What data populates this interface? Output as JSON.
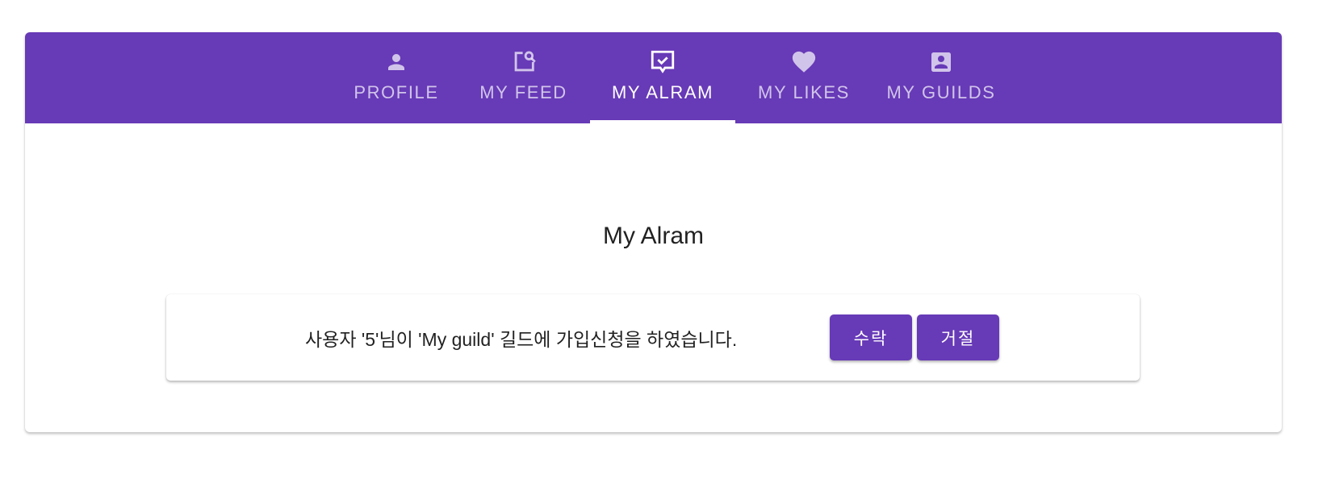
{
  "tabs": [
    {
      "label": "PROFILE",
      "icon": "person-icon",
      "active": false
    },
    {
      "label": "MY FEED",
      "icon": "post-search-icon",
      "active": false
    },
    {
      "label": "MY ALRAM",
      "icon": "chat-check-icon",
      "active": true
    },
    {
      "label": "MY LIKES",
      "icon": "heart-icon",
      "active": false
    },
    {
      "label": "MY GUILDS",
      "icon": "account-box-icon",
      "active": false
    }
  ],
  "page": {
    "title": "My Alram"
  },
  "notifications": [
    {
      "message": "사용자 '5'님이 'My guild' 길드에 가입신청을 하였습니다.",
      "accept_label": "수락",
      "reject_label": "거절"
    }
  ],
  "colors": {
    "primary": "#673ab7",
    "background": "#ffffff",
    "tab_inactive_text": "rgba(255,255,255,0.7)",
    "tab_active_text": "#ffffff"
  }
}
